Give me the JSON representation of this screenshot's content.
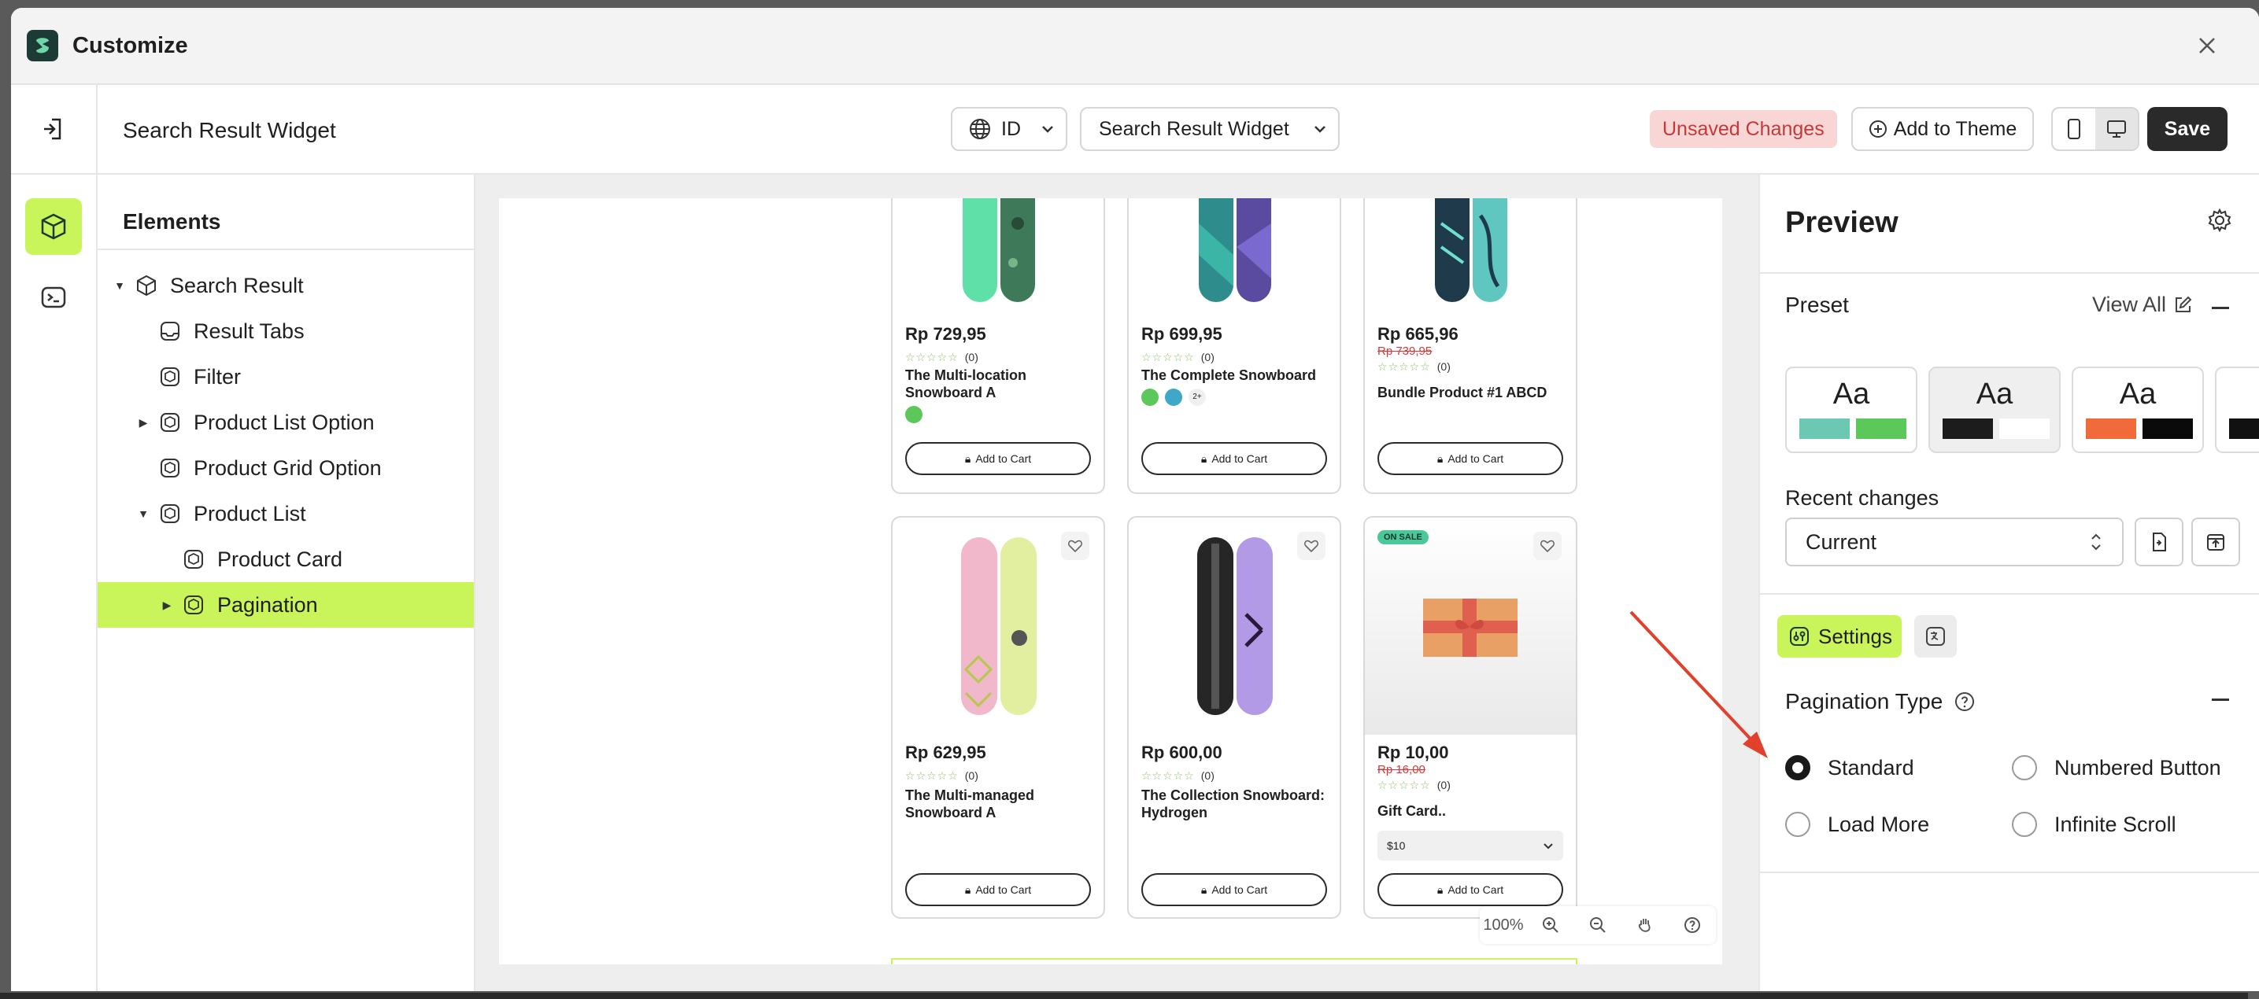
{
  "window": {
    "title": "Customize"
  },
  "topbar": {
    "page_name": "Search Result Widget",
    "language": "ID",
    "template": "Search Result Widget",
    "unsaved": "Unsaved Changes",
    "add_to_theme": "Add to Theme",
    "save": "Save"
  },
  "elements": {
    "title": "Elements",
    "nodes": [
      "Search Result",
      "Result Tabs",
      "Filter",
      "Product List Option",
      "Product Grid Option",
      "Product List",
      "Product Card",
      "Pagination"
    ]
  },
  "products": [
    {
      "price": "Rp 729,95",
      "old": "",
      "reviews": "(0)",
      "name": "The Multi-location Snowboard A",
      "cta": "Add to Cart",
      "swatches": [
        "#5cc85a"
      ]
    },
    {
      "price": "Rp 699,95",
      "old": "",
      "reviews": "(0)",
      "name": "The Complete Snowboard",
      "cta": "Add to Cart",
      "swatches": [
        "#5cc85a",
        "#3fa8c9"
      ],
      "more": "2+"
    },
    {
      "price": "Rp 665,96",
      "old": "Rp 739,95",
      "reviews": "(0)",
      "name": "Bundle Product #1 ABCD",
      "cta": "Add to Cart"
    },
    {
      "price": "Rp 629,95",
      "old": "",
      "reviews": "(0)",
      "name": "The Multi-managed Snowboard A",
      "cta": "Add to Cart"
    },
    {
      "price": "Rp 600,00",
      "old": "",
      "reviews": "(0)",
      "name": "The Collection Snowboard: Hydrogen",
      "cta": "Add to Cart"
    },
    {
      "price": "Rp 10,00",
      "old": "Rp 16,00",
      "reviews": "(0)",
      "name": "Gift Card..",
      "cta": "Add to Cart",
      "badge": "ON SALE",
      "variant": "$10"
    }
  ],
  "zoom": {
    "level": "100%"
  },
  "preview": {
    "title": "Preview",
    "preset_label": "Preset",
    "view_all": "View All",
    "preset_sample": "Aa",
    "preset_colors": [
      [
        "#6cc7b3",
        "#5cc85a"
      ],
      [
        "#1c1c1c",
        "#ffffff"
      ],
      [
        "#f06a3a",
        "#0a0a0a"
      ]
    ],
    "recent_label": "Recent changes",
    "recent_value": "Current",
    "settings_tab": "Settings",
    "pagination_type": "Pagination Type",
    "options": [
      "Standard",
      "Numbered Button",
      "Load More",
      "Infinite Scroll"
    ],
    "selected": "Standard"
  },
  "colors": {
    "accent": "#c9f55a",
    "annotation_arrow": "#e0402c"
  }
}
